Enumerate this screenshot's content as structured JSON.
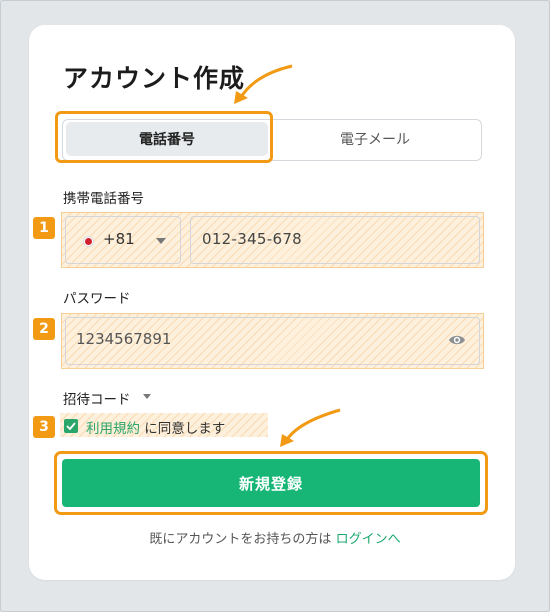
{
  "title": "アカウント作成",
  "tabs": {
    "phone": "電話番号",
    "email": "電子メール"
  },
  "phone": {
    "label": "携帯電話番号",
    "country_code": "+81",
    "value": "012-345-678"
  },
  "password": {
    "label": "パスワード",
    "value": "1234567891"
  },
  "invite": {
    "label": "招待コード"
  },
  "agreement": {
    "terms_link": "利用規約",
    "text": "に同意します",
    "checked": true
  },
  "submit_label": "新規登録",
  "footer": {
    "text": "既にアカウントをお持ちの方は",
    "login_link": "ログインへ"
  },
  "badges": [
    "1",
    "2",
    "3"
  ],
  "colors": {
    "accent_green": "#17b676",
    "highlight_orange": "#f29a14"
  }
}
